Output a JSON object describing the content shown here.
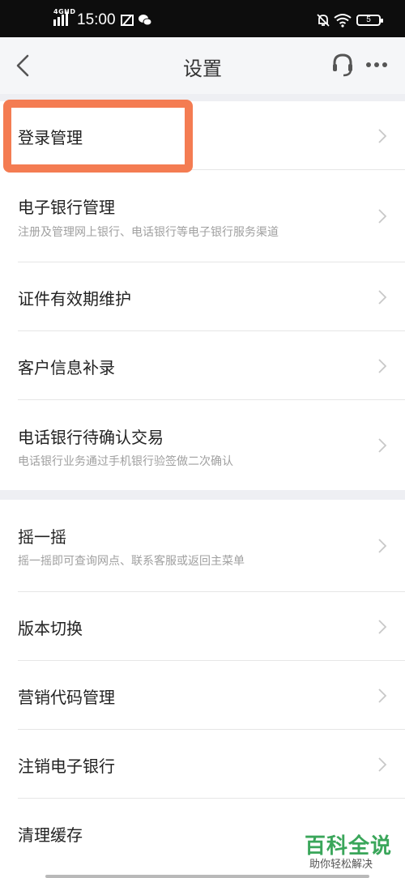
{
  "status_bar": {
    "network": "4GHD",
    "time": "15:00",
    "battery": "5"
  },
  "nav": {
    "title": "设置"
  },
  "group1": [
    {
      "label": "登录管理",
      "sub": ""
    },
    {
      "label": "电子银行管理",
      "sub": "注册及管理网上银行、电话银行等电子银行服务渠道"
    },
    {
      "label": "证件有效期维护",
      "sub": ""
    },
    {
      "label": "客户信息补录",
      "sub": ""
    },
    {
      "label": "电话银行待确认交易",
      "sub": "电话银行业务通过手机银行验签做二次确认"
    }
  ],
  "group2": [
    {
      "label": "摇一摇",
      "sub": "摇一摇即可查询网点、联系客服或返回主菜单"
    },
    {
      "label": "版本切换",
      "sub": ""
    },
    {
      "label": "营销代码管理",
      "sub": ""
    },
    {
      "label": "注销电子银行",
      "sub": ""
    },
    {
      "label": "清理缓存",
      "sub": ""
    }
  ],
  "watermark": {
    "brand": "百科全说",
    "slogan": "助你轻松解决"
  },
  "colors": {
    "highlight": "#f47c52",
    "brand": "#3aa65a"
  }
}
